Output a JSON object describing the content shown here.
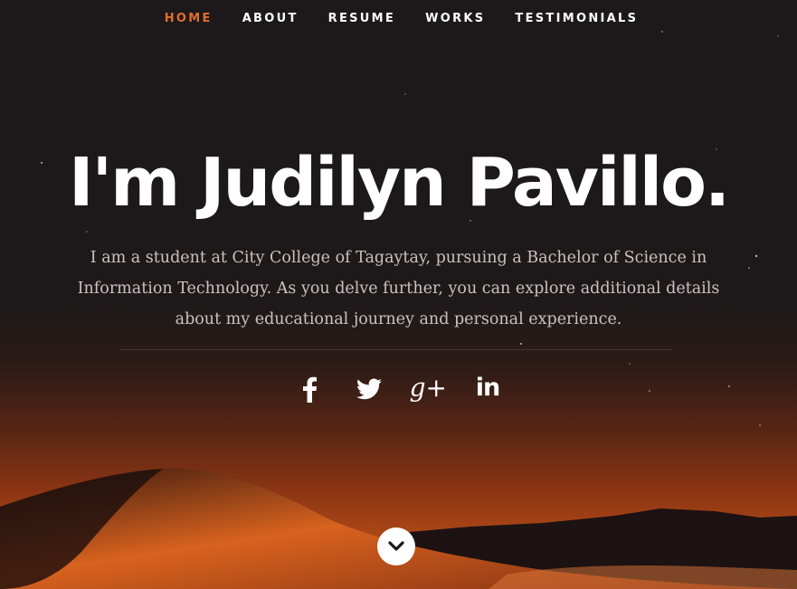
{
  "nav": {
    "items": [
      {
        "label": "HOME",
        "active": true
      },
      {
        "label": "ABOUT",
        "active": false
      },
      {
        "label": "RESUME",
        "active": false
      },
      {
        "label": "WORKS",
        "active": false
      },
      {
        "label": "TESTIMONIALS",
        "active": false
      }
    ]
  },
  "hero": {
    "headline": "I'm Judilyn Pavillo.",
    "intro": "I am a student at City College of Tagaytay, pursuing a Bachelor of Science in Information Technology. As you delve further, you can explore additional details about my educational journey and personal experience."
  },
  "social": {
    "icons": [
      "facebook-icon",
      "twitter-icon",
      "google-plus-icon",
      "linkedin-icon"
    ],
    "googleplus_glyph": "g+",
    "linkedin_glyph": "in"
  },
  "scroll": {
    "icon": "chevron-down-icon"
  },
  "colors": {
    "accent": "#e16d2b",
    "text": "#ffffff",
    "intro_text": "#c9c3c0",
    "background": "#1b1718"
  }
}
